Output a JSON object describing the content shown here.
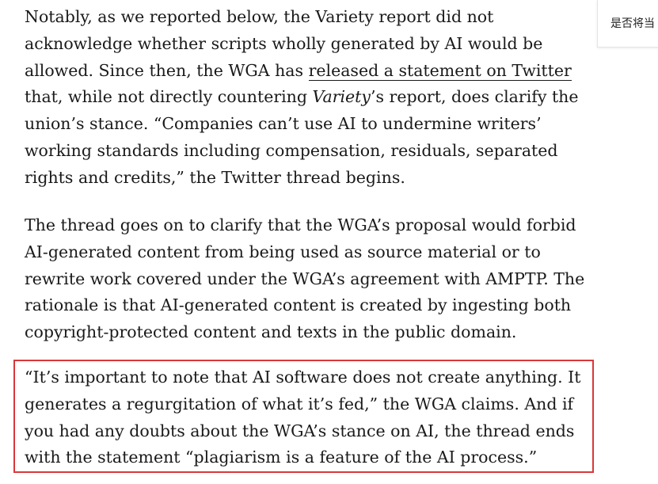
{
  "article": {
    "p1": {
      "before_link": "Notably, as we reported below, the Variety report did not acknowledge whether scripts wholly generated by AI would be allowed. Since then, the WGA has ",
      "link_text": "released a statement on Twitter",
      "after_link_1": " that, while not directly countering ",
      "italic": "Variety",
      "after_italic": "’s report, does clarify the union’s stance. “Companies can’t use AI to undermine writers’ working standards including compensation, residuals, separated rights and credits,” the Twitter thread begins."
    },
    "p2": "The thread goes on to clarify that the WGA’s proposal would forbid AI-generated content from being used as source material or to rewrite work covered under the WGA’s agreement with AMPTP. The rationale is that AI-generated content is created by ingesting both copyright-protected content and texts in the public domain.",
    "p3": "“It’s important to note that AI software does not create anything. It generates a regurgitation of what it’s fed,” the WGA claims. And if you had any doubts about the WGA’s stance on AI, the thread ends with the statement “plagiarism is a feature of the AI process.”"
  },
  "side_popup": {
    "text": "是否将当"
  },
  "colors": {
    "highlight_border": "#d9383a",
    "text": "#1a1a1a"
  }
}
